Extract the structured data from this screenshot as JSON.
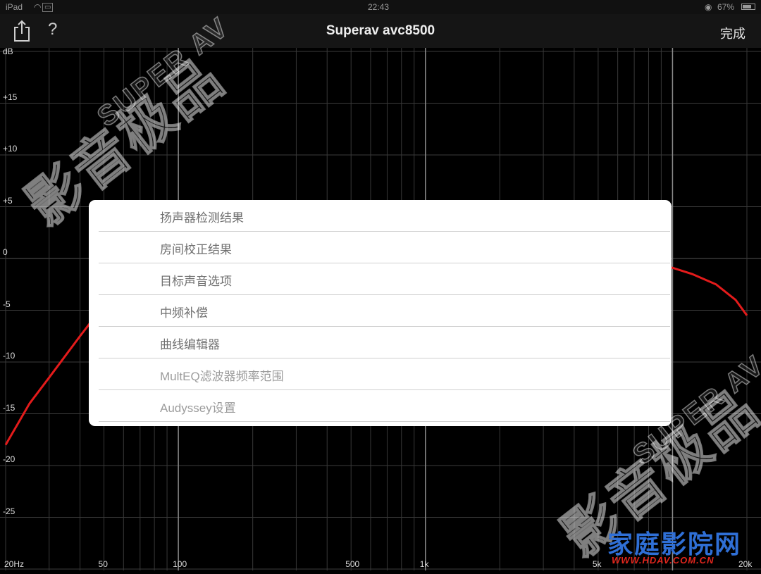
{
  "status_bar": {
    "device": "iPad",
    "time": "22:43",
    "battery": "67%"
  },
  "nav": {
    "title": "Superav avc8500",
    "done_label": "完成",
    "help_glyph": "?"
  },
  "graph": {
    "y_axis_unit": "dB",
    "y_ticks": [
      {
        "label": "+15",
        "value": 15
      },
      {
        "label": "+10",
        "value": 10
      },
      {
        "label": "+5",
        "value": 5
      },
      {
        "label": "0",
        "value": 0
      },
      {
        "label": "-5",
        "value": -5
      },
      {
        "label": "-10",
        "value": -10
      },
      {
        "label": "-15",
        "value": -15
      },
      {
        "label": "-20",
        "value": -20
      },
      {
        "label": "-25",
        "value": -25
      }
    ],
    "x_ticks": [
      {
        "label": "20Hz",
        "value": 20
      },
      {
        "label": "50",
        "value": 50
      },
      {
        "label": "100",
        "value": 100
      },
      {
        "label": "500",
        "value": 500
      },
      {
        "label": "1k",
        "value": 1000
      },
      {
        "label": "5k",
        "value": 5000
      },
      {
        "label": "20k",
        "value": 20000
      }
    ],
    "curve_color": "#e31b1b",
    "curve_points": [
      [
        20,
        -18
      ],
      [
        25,
        -14
      ],
      [
        30,
        -11.5
      ],
      [
        40,
        -7.5
      ],
      [
        50,
        -4.5
      ],
      [
        60,
        -2.5
      ],
      [
        5000,
        -0.5
      ],
      [
        8000,
        -0.6
      ],
      [
        10000,
        -0.9
      ],
      [
        12000,
        -1.5
      ],
      [
        15000,
        -2.5
      ],
      [
        18000,
        -4
      ],
      [
        20000,
        -5.5
      ]
    ]
  },
  "menu": {
    "items": [
      {
        "label": "扬声器检测结果"
      },
      {
        "label": "房间校正结果"
      },
      {
        "label": "目标声音选项"
      },
      {
        "label": "中频补偿"
      },
      {
        "label": "曲线编辑器"
      },
      {
        "label": "MultEQ滤波器频率范围"
      },
      {
        "label": "Audyssey设置"
      }
    ]
  },
  "watermark": {
    "chinese": "影音极品",
    "english": "SUPER AV"
  },
  "logo": {
    "text": "家庭影院网",
    "url": "WWW.HDAV.COM.CN"
  }
}
